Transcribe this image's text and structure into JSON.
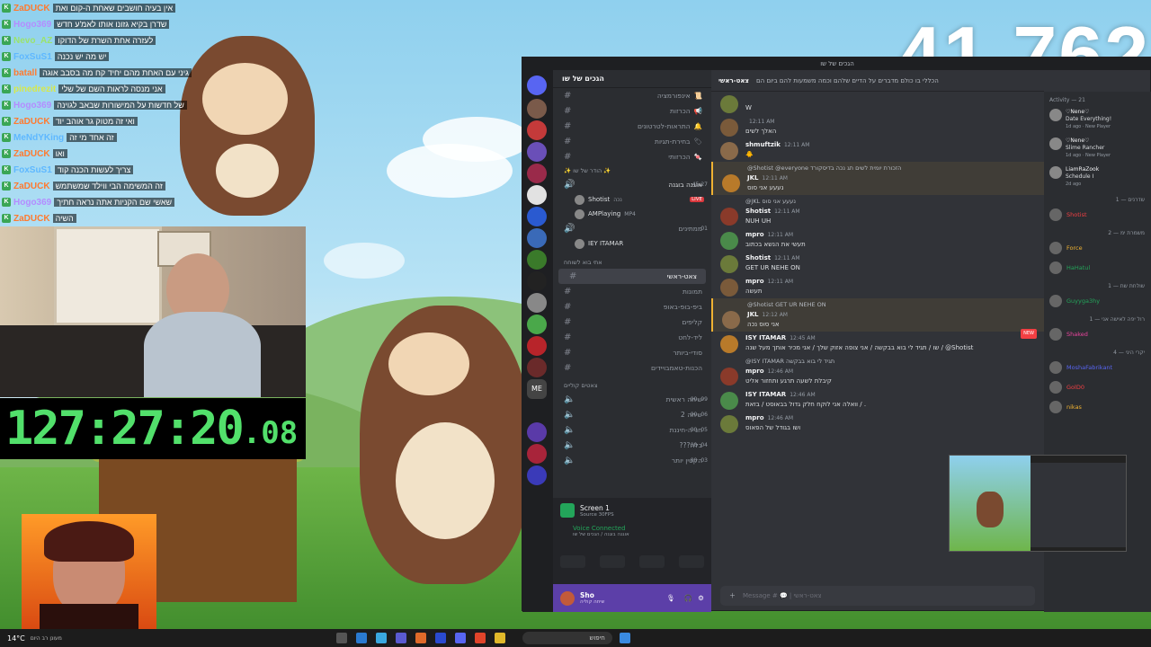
{
  "viewer_count": "41,762",
  "timer": {
    "main": "127:27:20",
    "fraction": ".08"
  },
  "chat": [
    {
      "user": "ZaDUCK",
      "color": "#ff7a2f",
      "text": "אין בעיה חושבים שאחת ה-קום ואת"
    },
    {
      "user": "Hogo369",
      "color": "#b48cff",
      "text": "שדרן בקיא גזונו אותו לאמ'ע חדש"
    },
    {
      "user": "Nevo_AZ",
      "color": "#9be36b",
      "text": "לעזרה אחת השרת של הדוקו"
    },
    {
      "user": "FoxSuS1",
      "color": "#5fb8ff",
      "text": "יש מה יש נכנה"
    },
    {
      "user": "batall",
      "color": "#ff7a2f",
      "text": "גיני עם האחת מהם יחיד קח מה בסבב אוגה"
    },
    {
      "user": "pinedrezit",
      "color": "#d7e84a",
      "text": "אני מנסה לראות השם של שלי"
    },
    {
      "user": "Hogo369",
      "color": "#b48cff",
      "text": "של חדשות על המישורות שבאב לגוינה"
    },
    {
      "user": "ZaDUCK",
      "color": "#ff7a2f",
      "text": "ואי זה מטוק גר אוהב יוד"
    },
    {
      "user": "MeNdYKing",
      "color": "#5fb8ff",
      "text": "זה אחד מי זה"
    },
    {
      "user": "ZaDUCK",
      "color": "#ff7a2f",
      "text": "ואו"
    },
    {
      "user": "FoxSuS1",
      "color": "#5fb8ff",
      "text": "צריך לעשות הכנה קוד"
    },
    {
      "user": "ZaDUCK",
      "color": "#ff7a2f",
      "text": "זה המשימה הבי ווילד שמשתמש"
    },
    {
      "user": "Hogo369",
      "color": "#b48cff",
      "text": "שאשי שם הקניות אתה נראה חתיך"
    },
    {
      "user": "ZaDUCK",
      "color": "#ff7a2f",
      "text": "השיה"
    }
  ],
  "discord": {
    "window_title": "הגכים של שו",
    "server_name": "הגכים של שו",
    "channel_header": "צאט-ראשי",
    "channel_topic": "הכללי בו כולם מדברים על הדיים שלהם וכמה משמעות להם ביום הם",
    "text_channels_top": [
      {
        "name": "אינפורמציה",
        "emoji": "📜"
      },
      {
        "name": "הכרזות",
        "emoji": "📢"
      },
      {
        "name": "התראות-לטרטונים",
        "emoji": "🔔"
      },
      {
        "name": "בחירת-תגיות",
        "emoji": "🏷"
      },
      {
        "name": "הכרזותי",
        "emoji": "🍬"
      }
    ],
    "live_category": "✨ הודר של שו ✨",
    "live_channel": "אוגנה בוגנה",
    "live_channel_time": "45:27",
    "live_users": [
      {
        "name": "Shotist",
        "badge": "נכה",
        "live": "LIVE"
      },
      {
        "name": "AMPlaying",
        "badge": "MP4",
        "live": ""
      }
    ],
    "waiting_channel": "ממתינים",
    "waiting_counts": [
      "01",
      "99"
    ],
    "waiting_user": "IEY ITAMAR",
    "chat_category": "אתי בוא לשוחח",
    "text_channels": [
      {
        "name": "צאט-ראשי",
        "selected": true
      },
      {
        "name": "תמונות",
        "selected": false
      },
      {
        "name": "ביפ-בופ-באופ",
        "selected": false
      },
      {
        "name": "קליפים",
        "selected": false
      },
      {
        "name": "ליד-לחט",
        "selected": false
      },
      {
        "name": "סודי-ביותר",
        "selected": false
      },
      {
        "name": "הכנות-טאמבויידים",
        "selected": false
      }
    ],
    "voice_category": "צאטים קוליים",
    "voice_channels": [
      {
        "name": "שיחה ראשית",
        "count": "00",
        "max": "99"
      },
      {
        "name": "שיחה 2",
        "count": "00",
        "max": "06"
      },
      {
        "name": "חנייה-חיננת",
        "count": "00",
        "max": "05"
      },
      {
        "name": "???בלה",
        "count": "00",
        "max": "04"
      },
      {
        "name": "הקטין יותר",
        "count": "00",
        "max": "03"
      }
    ],
    "screen_share": {
      "title": "Screen 1",
      "subtitle": "Source 30FPS"
    },
    "voice_connected": {
      "status": "Voice Connected",
      "channel": "אוגנה בוגנה / הגכים של שו"
    },
    "user": {
      "name": "Sho",
      "status": "שיחה קוליה"
    },
    "composer_placeholder": "Message # 💬 | צאט-ראשי",
    "messages": [
      {
        "author": "",
        "time": "",
        "text": "W",
        "highlight": false,
        "reply": ""
      },
      {
        "author": "",
        "time": "12:11 AM",
        "text": "האלך לשים",
        "highlight": false,
        "reply": ""
      },
      {
        "author": "shmuftzik",
        "time": "12:11 AM",
        "text": "🐥",
        "highlight": false,
        "reply": ""
      },
      {
        "author": "JKL",
        "time": "12:11 AM",
        "text": "נעעע אני סוס",
        "highlight": true,
        "reply": "@Shotist @everyone הזכורת יומית לשים תג נכה בדיסקורד"
      },
      {
        "author": "Shotist",
        "time": "12:11 AM",
        "text": "NUH UH",
        "highlight": false,
        "reply": "@JKL נעעע אני סוס"
      },
      {
        "author": "mpro",
        "time": "12:11 AM",
        "text": "תעשי את הנשא בכתוב",
        "highlight": false,
        "reply": ""
      },
      {
        "author": "Shotist",
        "time": "12:11 AM",
        "text": "GET UR NEHE ON",
        "highlight": false,
        "reply": ""
      },
      {
        "author": "mpro",
        "time": "12:11 AM",
        "text": "תעשה",
        "highlight": false,
        "reply": ""
      },
      {
        "author": "JKL",
        "time": "12:12 AM",
        "text": "אני סוס נכה",
        "highlight": true,
        "reply": "@Shotist GET UR NEHE ON"
      },
      {
        "author": "ISY ITAMAR",
        "time": "12:45 AM",
        "text": "שו / תגיד לי בוא בבקשה / אני צופה אזוק שלך / אני מכיר אותך מעל שנה / @Shotist",
        "highlight": false,
        "reply": ""
      },
      {
        "author": "mpro",
        "time": "12:46 AM",
        "text": "קיבלת לשעה תרגע ותחזור אליט",
        "highlight": false,
        "reply": "@ISY ITAMAR תגיד לי בוא בבקשה"
      },
      {
        "author": "ISY ITAMAR",
        "time": "12:46 AM",
        "text": "וואלה אני לוקח חלק גדול בבאוסט / בזאת / .",
        "highlight": false,
        "reply": ""
      },
      {
        "author": "mpro",
        "time": "12:46 AM",
        "text": "ושו בגודל של הפאוס",
        "highlight": false,
        "reply": ""
      }
    ],
    "new_badge": "NEW",
    "members_header": "Activity — 21",
    "activity": [
      {
        "name": "♡Nene♡",
        "line1": "Date Everything!",
        "line2": "1d ago · New Player"
      },
      {
        "name": "♡Nene♡",
        "line1": "Slime Rancher",
        "line2": "1d ago · New Player"
      },
      {
        "name": "LiamRaZook",
        "line1": "Schedule I",
        "line2": "2d ago"
      }
    ],
    "member_groups": [
      {
        "title": "שדרנים — 1",
        "members": [
          "Shotist"
        ]
      },
      {
        "title": "משמרת ימ — 2",
        "members": [
          "Force",
          "HaHatul"
        ]
      },
      {
        "title": "שולחת שת — 1",
        "members": [
          "Guyyga3hy"
        ]
      },
      {
        "title": "רול יפה לאישה אני — 1",
        "members": [
          "Shaked"
        ]
      },
      {
        "title": "יקרי היני — 4",
        "members": [
          "MoshaFabrikant",
          "GolD0",
          "nikas"
        ]
      }
    ]
  },
  "taskbar": {
    "search": "חיפוש",
    "weather": "14°C",
    "weather_note": "מעונן רב היום"
  }
}
